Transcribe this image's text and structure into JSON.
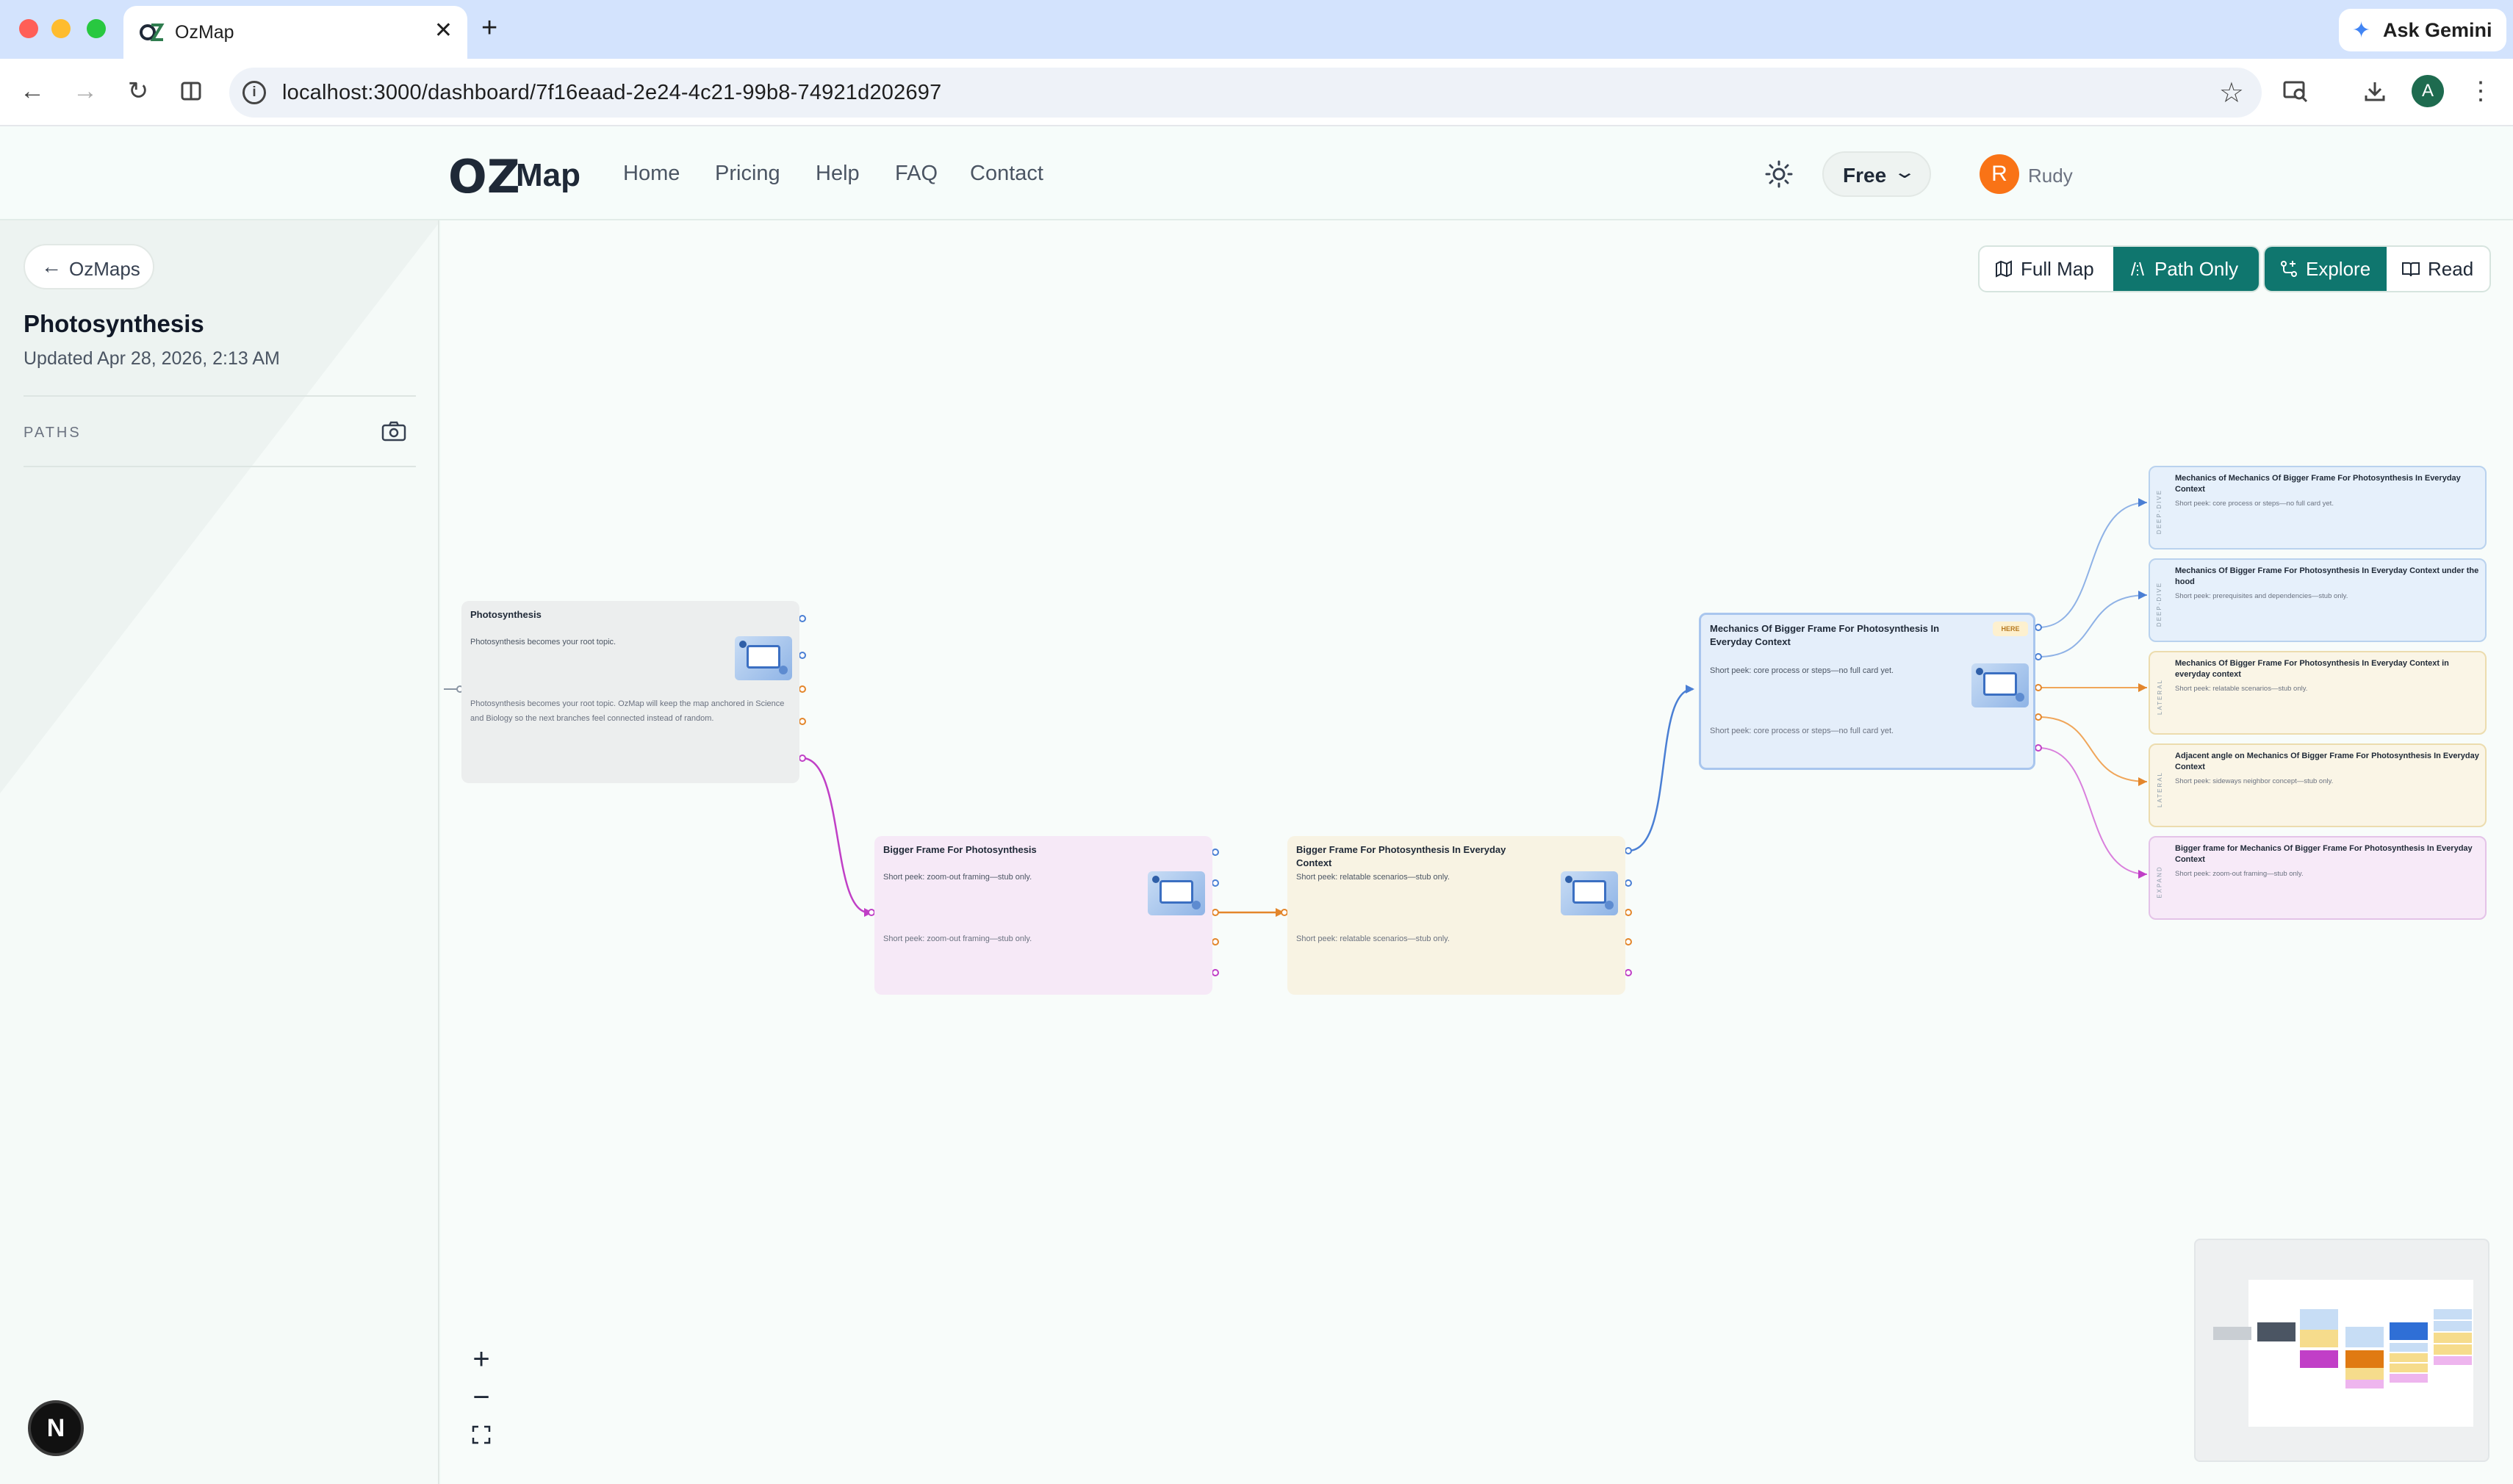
{
  "browser": {
    "tab_title": "OzMap",
    "tab_close": "✕",
    "new_tab": "+",
    "ask_gemini": "Ask Gemini",
    "url": "localhost:3000/dashboard/7f16eaad-2e24-4c21-99b8-74921d202697",
    "profile_initial": "A"
  },
  "header": {
    "logo_o": "OZ",
    "logo_text": "Map",
    "nav": [
      "Home",
      "Pricing",
      "Help",
      "FAQ",
      "Contact"
    ],
    "plan_label": "Free",
    "user_initial": "R",
    "user_name": "Rudy"
  },
  "sidebar": {
    "back_label": "OzMaps",
    "map_title": "Photosynthesis",
    "updated": "Updated Apr 28, 2026, 2:13 AM",
    "paths_label": "PATHS"
  },
  "view_controls": {
    "full_map": "Full Map",
    "path_only": "Path Only",
    "explore": "Explore",
    "read": "Read"
  },
  "nodes": {
    "root": {
      "title": "Photosynthesis",
      "peek": "Photosynthesis becomes your root topic.",
      "desc": "Photosynthesis becomes your root topic. OzMap will keep the map anchored in Science and Biology so the next branches feel connected instead of random."
    },
    "bigger_frame": {
      "title": "Bigger Frame For Photosynthesis",
      "peek": "Short peek: zoom-out framing—stub only.",
      "peek2": "Short peek: zoom-out framing—stub only."
    },
    "everyday": {
      "title": "Bigger Frame For Photosynthesis In Everyday Context",
      "peek": "Short peek: relatable scenarios—stub only.",
      "peek2": "Short peek: relatable scenarios—stub only."
    },
    "mechanics": {
      "title": "Mechanics Of Bigger Frame For Photosynthesis In Everyday Context",
      "badge": "HERE",
      "peek": "Short peek: core process or steps—no full card yet.",
      "peek2": "Short peek: core process or steps—no full card yet."
    },
    "branches": [
      {
        "tag": "DEEP-DIVE",
        "title": "Mechanics of Mechanics Of Bigger Frame For Photosynthesis In Everyday Context",
        "peek": "Short peek: core process or steps—no full card yet.",
        "color": "#e6f0fb",
        "border": "#b9d2ee"
      },
      {
        "tag": "DEEP-DIVE",
        "title": "Mechanics Of Bigger Frame For Photosynthesis In Everyday Context under the hood",
        "peek": "Short peek: prerequisites and dependencies—stub only.",
        "color": "#e6f0fb",
        "border": "#b9d2ee"
      },
      {
        "tag": "LATERAL",
        "title": "Mechanics Of Bigger Frame For Photosynthesis In Everyday Context in everyday context",
        "peek": "Short peek: relatable scenarios—stub only.",
        "color": "#faf5e6",
        "border": "#ecdcae"
      },
      {
        "tag": "LATERAL",
        "title": "Adjacent angle on Mechanics Of Bigger Frame For Photosynthesis In Everyday Context",
        "peek": "Short peek: sideways neighbor concept—stub only.",
        "color": "#faf5e6",
        "border": "#ecdcae"
      },
      {
        "tag": "EXPAND",
        "title": "Bigger frame for Mechanics Of Bigger Frame For Photosynthesis In Everyday Context",
        "peek": "Short peek: zoom-out framing—stub only.",
        "color": "#f7eaf8",
        "border": "#e4c3e8"
      }
    ]
  },
  "colors": {
    "accent": "#0f766e",
    "blue_edge": "#4a7fd4",
    "orange_edge": "#e3862b",
    "magenta_edge": "#c03fc6"
  },
  "controls": {
    "zoom_in": "+",
    "zoom_out": "−",
    "next_badge": "N"
  }
}
